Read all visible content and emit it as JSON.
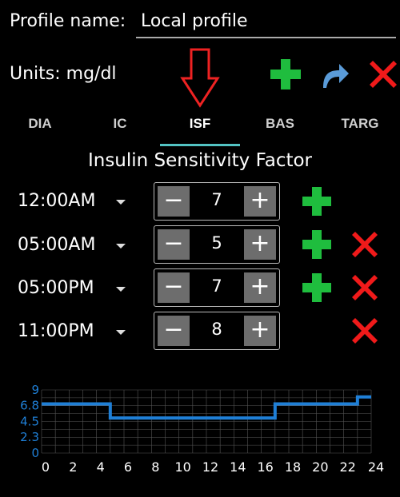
{
  "profile": {
    "name_label": "Profile name:",
    "name_value": "Local profile"
  },
  "units": {
    "label": "Units: mg/dl"
  },
  "toolbar": {
    "add_icon": "plus-icon",
    "undo_icon": "undo-icon",
    "delete_icon": "close-icon"
  },
  "tabs": [
    {
      "label": "DIA"
    },
    {
      "label": "IC"
    },
    {
      "label": "ISF",
      "active": true
    },
    {
      "label": "BAS"
    },
    {
      "label": "TARG"
    }
  ],
  "section": {
    "title": "Insulin Sensitivity Factor"
  },
  "rows": [
    {
      "time": "12:00AM",
      "value": "7",
      "minus": "−",
      "plus": "+",
      "add": true,
      "remove": false
    },
    {
      "time": "05:00AM",
      "value": "5",
      "minus": "−",
      "plus": "+",
      "add": true,
      "remove": true
    },
    {
      "time": "05:00PM",
      "value": "7",
      "minus": "−",
      "plus": "+",
      "add": true,
      "remove": true
    },
    {
      "time": "11:00PM",
      "value": "8",
      "minus": "−",
      "plus": "+",
      "add": false,
      "remove": true
    }
  ],
  "colors": {
    "add": "#1fbd3e",
    "delete": "#f01a1a",
    "undo": "#5a9bd8",
    "accent": "#53c3c3",
    "graph": "#1f7fd6"
  },
  "chart_data": {
    "type": "line",
    "step": true,
    "x_ticks": [
      "0",
      "2",
      "4",
      "6",
      "8",
      "10",
      "12",
      "14",
      "16",
      "18",
      "20",
      "22",
      "24"
    ],
    "y_ticks": [
      "0",
      "2.3",
      "4.5",
      "6.8",
      "9"
    ],
    "xlim": [
      0,
      24
    ],
    "ylim": [
      0,
      9
    ],
    "grid": true,
    "series": [
      {
        "x": [
          0,
          5,
          17,
          23,
          24
        ],
        "y": [
          7,
          5,
          7,
          8,
          8
        ]
      }
    ]
  }
}
